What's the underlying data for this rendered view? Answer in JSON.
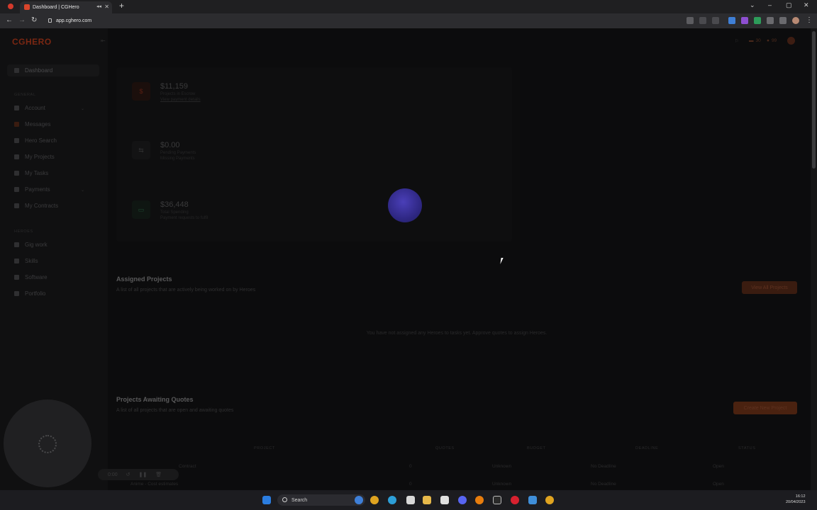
{
  "browser": {
    "tab_title": "Dashboard | CGHero",
    "url": "app.cghero.com"
  },
  "app": {
    "logo_text": "CGHERO",
    "sidebar": {
      "dashboard": "Dashboard",
      "section_general": "GENERAL",
      "items_general": [
        "Account",
        "Messages",
        "Hero Search",
        "My Projects",
        "My Tasks",
        "Payments",
        "My Contracts"
      ],
      "section_heroes": "HEROES",
      "items_heroes": [
        "Gig work",
        "Skills",
        "Software",
        "Portfolio"
      ]
    },
    "topbar": {
      "credits": "30",
      "notifications": "99"
    },
    "stats": [
      {
        "value": "$11,159",
        "label": "Projects in Escrow",
        "link": "View payment details",
        "icon": "$"
      },
      {
        "value": "$0.00",
        "label": "Pending Payments",
        "link": "Missing Payments",
        "icon": "⇆"
      },
      {
        "value": "$36,448",
        "label": "Total Spending",
        "link": "Payment requests to fulfil",
        "icon": "▭"
      }
    ],
    "assigned": {
      "title": "Assigned Projects",
      "subtitle": "A list of all projects that are actively being worked on by Heroes",
      "button": "View All Projects",
      "empty": "You have not assigned any Heroes to tasks yet. Approve quotes to assign Heroes."
    },
    "awaiting": {
      "title": "Projects Awaiting Quotes",
      "subtitle": "A list of all projects that are open and awaiting quotes",
      "button": "Create New Project",
      "columns": [
        "PROJECT",
        "QUOTES",
        "BUDGET",
        "DEADLINE",
        "STATUS"
      ],
      "rows": [
        {
          "project": "Contract",
          "quotes": "0",
          "budget": "Unknown",
          "deadline": "No Deadline",
          "status": "Open"
        },
        {
          "project": "Anime - Cost estimates",
          "quotes": "0",
          "budget": "Unknown",
          "deadline": "No Deadline",
          "status": "Open"
        }
      ]
    },
    "recorder": {
      "time": "0:00"
    }
  },
  "taskbar": {
    "search": "Search",
    "time": "16:12",
    "date": "20/04/2023"
  }
}
